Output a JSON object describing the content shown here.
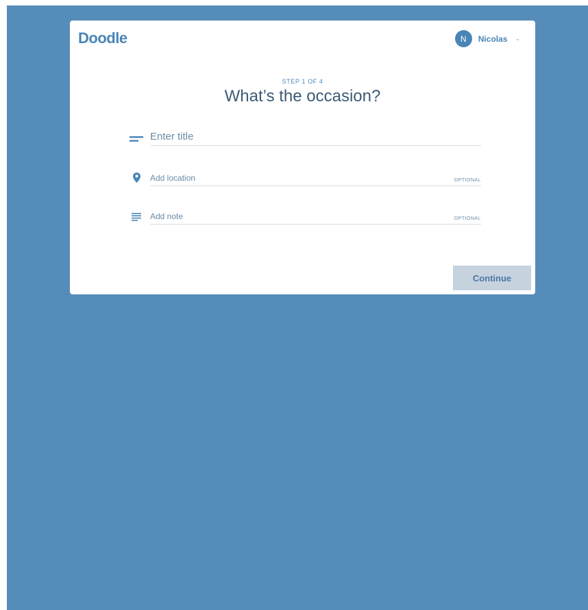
{
  "brand": {
    "logo_text": "Doodle",
    "accent_color": "#4a85b7",
    "background_color": "#568cb9"
  },
  "user": {
    "initial": "N",
    "name": "Nicolas",
    "menu_icon": "chevron-down-icon"
  },
  "wizard": {
    "step_label": "STEP 1 OF 4",
    "heading": "What’s the occasion?"
  },
  "form": {
    "title": {
      "placeholder": "Enter title",
      "value": "",
      "icon": "short-text-icon"
    },
    "location": {
      "placeholder": "Add location",
      "value": "",
      "optional_label": "OPTIONAL",
      "icon": "map-pin-icon"
    },
    "note": {
      "placeholder": "Add note",
      "value": "",
      "optional_label": "OPTIONAL",
      "icon": "notes-lines-icon"
    }
  },
  "actions": {
    "continue_label": "Continue",
    "continue_enabled": false
  }
}
